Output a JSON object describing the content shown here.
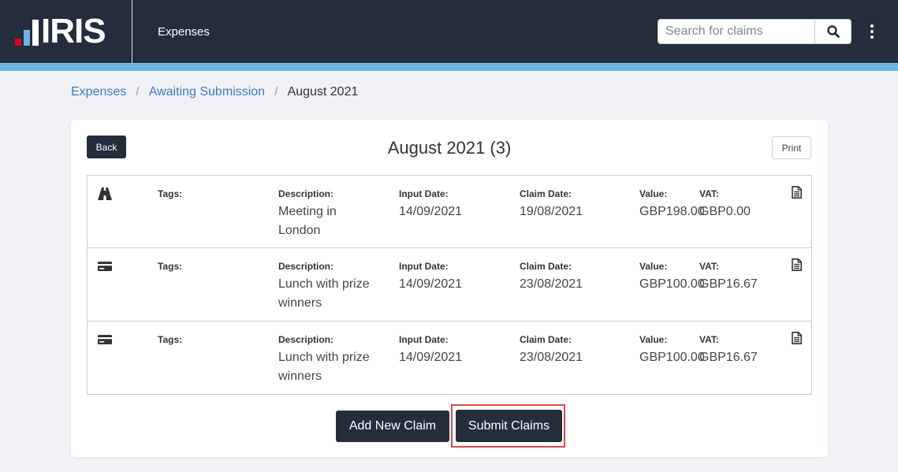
{
  "header": {
    "logo_text": "IRIS",
    "app_title": "Expenses",
    "search": {
      "placeholder": "Search for claims",
      "value": ""
    },
    "colors": {
      "bar": "#232d3c",
      "accent": "#6cb4e4",
      "logo_red": "#e2001a"
    }
  },
  "breadcrumb": {
    "items": [
      "Expenses",
      "Awaiting Submission"
    ],
    "current": "August 2021"
  },
  "card": {
    "back_label": "Back",
    "title": "August 2021 (3)",
    "print_label": "Print",
    "labels": {
      "tags": "Tags:",
      "description": "Description:",
      "input_date": "Input Date:",
      "claim_date": "Claim Date:",
      "value": "Value:",
      "vat": "VAT:"
    },
    "claims": [
      {
        "type_icon": "road-icon",
        "tags": "",
        "description": "Meeting in London",
        "input_date": "14/09/2021",
        "claim_date": "19/08/2021",
        "value": "GBP198.00",
        "vat": "GBP0.00"
      },
      {
        "type_icon": "credit-card-icon",
        "tags": "",
        "description": "Lunch with prize winners",
        "input_date": "14/09/2021",
        "claim_date": "23/08/2021",
        "value": "GBP100.00",
        "vat": "GBP16.67"
      },
      {
        "type_icon": "credit-card-icon",
        "tags": "",
        "description": "Lunch with prize winners",
        "input_date": "14/09/2021",
        "claim_date": "23/08/2021",
        "value": "GBP100.00",
        "vat": "GBP16.67"
      }
    ],
    "add_label": "Add New Claim",
    "submit_label": "Submit Claims"
  }
}
